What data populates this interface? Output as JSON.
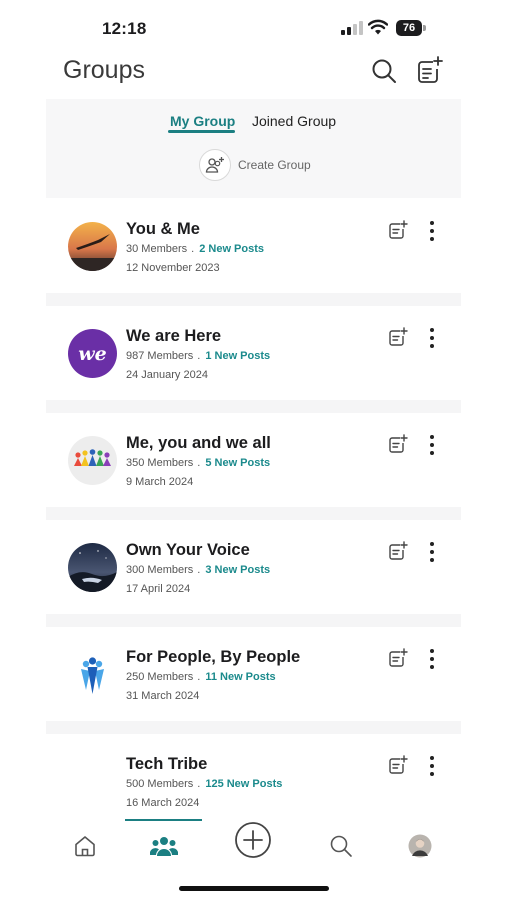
{
  "status_bar": {
    "time": "12:18",
    "battery": "76"
  },
  "header": {
    "title": "Groups",
    "search_icon": "search-icon",
    "new_post_icon": "new-post-icon"
  },
  "tabs": [
    {
      "label": "My Group",
      "active": true
    },
    {
      "label": "Joined Group",
      "active": false
    }
  ],
  "create_group": {
    "label": "Create Group",
    "icon": "add-people-icon"
  },
  "groups": [
    {
      "name": "You & Me",
      "members": "30 Members",
      "separator": ".",
      "new_posts": "2 New Posts",
      "date": "12 November 2023",
      "avatar": "sunset-bird-photo"
    },
    {
      "name": "We are Here",
      "members": "987 Members",
      "separator": ".",
      "new_posts": "1 New Posts",
      "date": "24 January 2024",
      "avatar": "we-logo",
      "avatar_text": "we"
    },
    {
      "name": "Me, you and we all",
      "members": "350 Members",
      "separator": ".",
      "new_posts": "5 New Posts",
      "date": "9 March 2024",
      "avatar": "people-circle-logo"
    },
    {
      "name": "Own Your Voice",
      "members": "300 Members",
      "separator": ".",
      "new_posts": "3 New Posts",
      "date": "17 April 2024",
      "avatar": "night-sky-photo"
    },
    {
      "name": "For People, By People",
      "members": "250 Members",
      "separator": ".",
      "new_posts": "11 New Posts",
      "date": "31 March 2024",
      "avatar": "blue-people-logo"
    },
    {
      "name": "Tech Tribe",
      "members": "500 Members",
      "separator": ".",
      "new_posts": "125 New Posts",
      "date": "16 March 2024",
      "avatar": "none"
    }
  ],
  "bottom_nav": [
    {
      "name": "home",
      "icon": "home-icon"
    },
    {
      "name": "groups",
      "icon": "groups-icon",
      "active": true
    },
    {
      "name": "create",
      "icon": "plus-circle-icon"
    },
    {
      "name": "search",
      "icon": "search-icon"
    },
    {
      "name": "profile",
      "icon": "avatar"
    }
  ],
  "colors": {
    "accent": "#1b7f82",
    "posts": "#1b8a8c",
    "panel": "#f7f7f8",
    "we_logo": "#6a2fa6"
  }
}
